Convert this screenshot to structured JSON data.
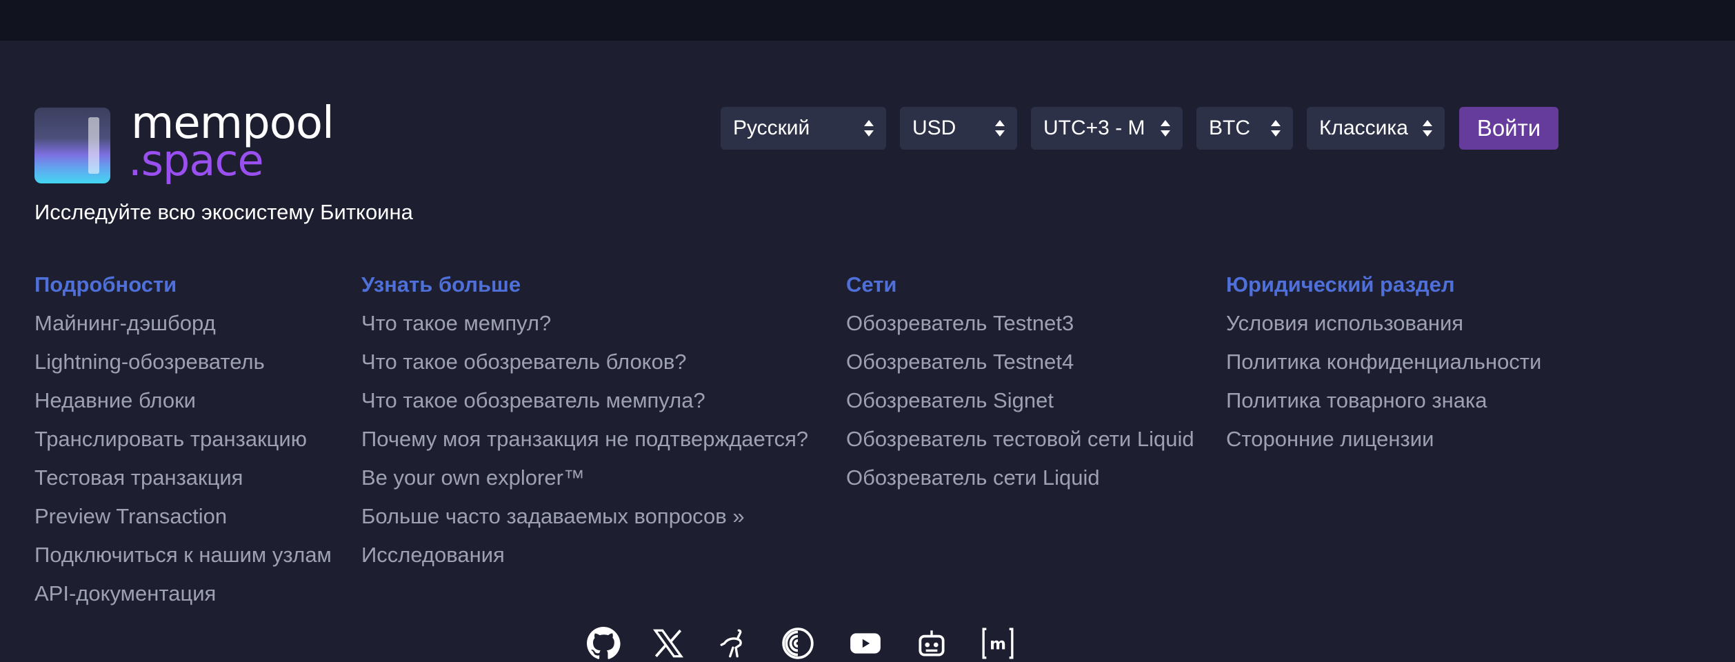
{
  "logo": {
    "word": "mempool",
    "sub": ".space"
  },
  "tagline": "Исследуйте всю экосистему Биткоина",
  "selectors": {
    "language": "Русский",
    "currency": "USD",
    "timezone": "UTC+3 - M",
    "unit": "BTC",
    "theme": "Классика"
  },
  "login_label": "Войти",
  "columns": [
    {
      "title": "Подробности",
      "links": [
        "Майнинг-дэшборд",
        "Lightning-обозреватель",
        "Недавние блоки",
        "Транслировать транзакцию",
        "Тестовая транзакция",
        "Preview Transaction",
        "Подключиться к нашим узлам",
        "API-документация"
      ]
    },
    {
      "title": "Узнать больше",
      "links": [
        "Что такое мемпул?",
        "Что такое обозреватель блоков?",
        "Что такое обозреватель мемпула?",
        "Почему моя транзакция не подтверждается?",
        "Be your own explorer™",
        "Больше часто задаваемых вопросов »",
        "Исследования"
      ]
    },
    {
      "title": "Сети",
      "links": [
        "Обозреватель Testnet3",
        "Обозреватель Testnet4",
        "Обозреватель Signet",
        "Обозреватель тестовой сети Liquid",
        "Обозреватель сети Liquid"
      ]
    },
    {
      "title": "Юридический раздел",
      "links": [
        "Условия использования",
        "Политика конфиденциальности",
        "Политика товарного знака",
        "Сторонние лицензии"
      ]
    }
  ],
  "social_icons": [
    "github-icon",
    "x-icon",
    "nostr-icon",
    "bluesky-icon",
    "youtube-icon",
    "telegram-icon",
    "matrix-icon"
  ],
  "colors": {
    "background": "#1d1f31",
    "topbar": "#11131f",
    "heading": "#4f6fd9",
    "link": "#9ea1b2",
    "accent": "#653b9c",
    "logo_sub": "#9a4ff0"
  }
}
